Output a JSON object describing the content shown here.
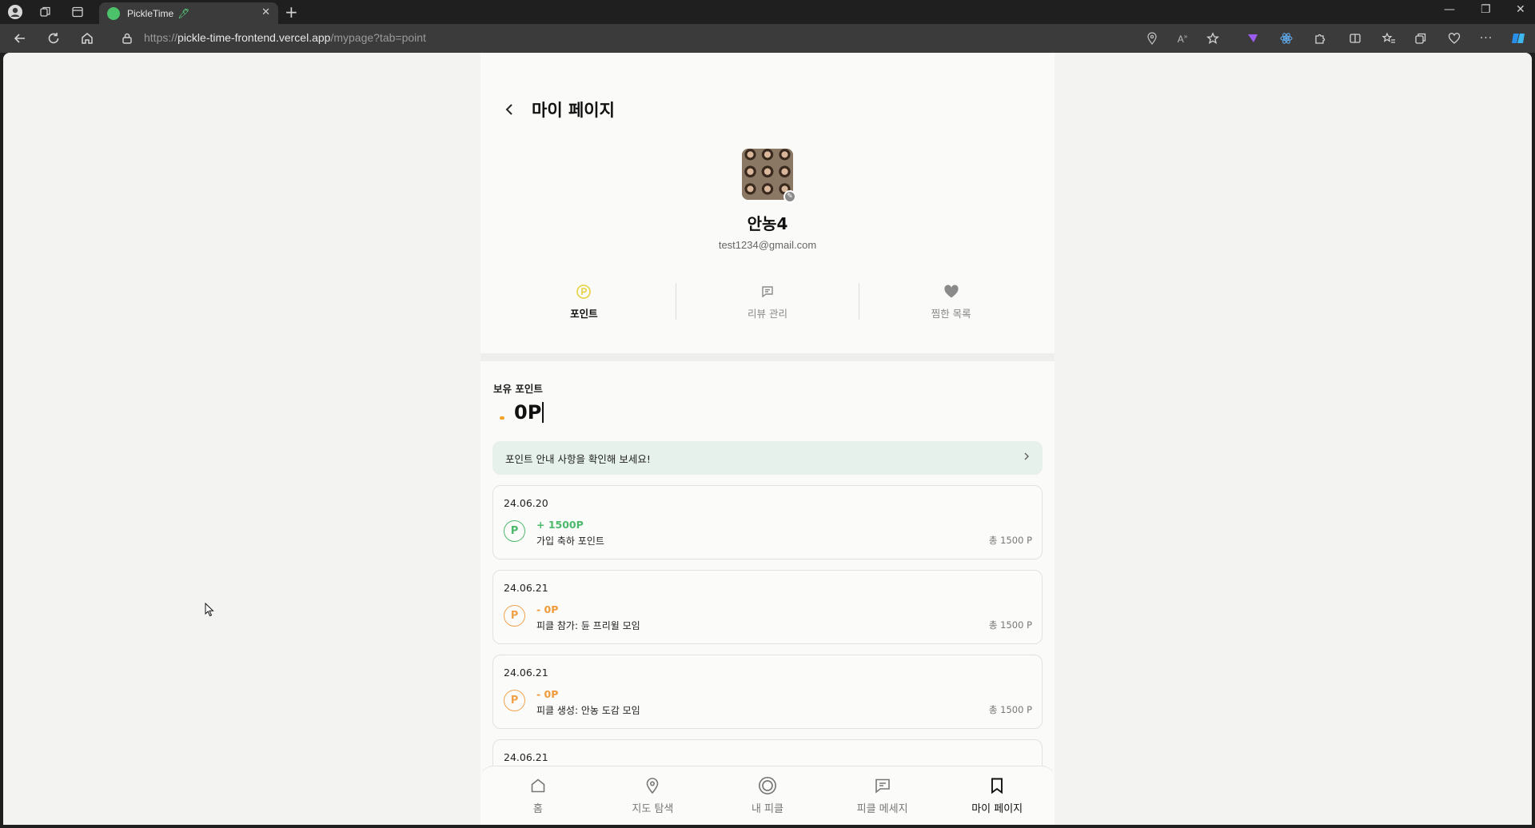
{
  "browser": {
    "tab_title": "PickleTime",
    "url_scheme": "https://",
    "url_domain": "pickle-time-frontend.vercel.app",
    "url_path": "/mypage?tab=point"
  },
  "page": {
    "title": "마이 페이지",
    "back_icon": "chevron-left-icon"
  },
  "profile": {
    "nickname": "안농4",
    "email": "test1234@gmail.com"
  },
  "tabs": [
    {
      "label": "포인트",
      "icon": "point-icon",
      "active": true
    },
    {
      "label": "리뷰 관리",
      "icon": "message-icon",
      "active": false
    },
    {
      "label": "찜한 목록",
      "icon": "heart-icon",
      "active": false
    }
  ],
  "points": {
    "label": "보유 포인트",
    "value": "0P",
    "guide_text": "포인트 안내 사항을 확인해 보세요!"
  },
  "history": [
    {
      "date": "24.06.20",
      "amount": "+ 1500P",
      "type": "plus",
      "desc": "가입 축하 포인트",
      "total": "총 1500 P",
      "icon_letter": "P"
    },
    {
      "date": "24.06.21",
      "amount": "- 0P",
      "type": "minus",
      "desc": "피클 참가: 듄 프리윌 모임",
      "total": "총 1500 P",
      "icon_letter": "P"
    },
    {
      "date": "24.06.21",
      "amount": "- 0P",
      "type": "minus",
      "desc": "피클 생성: 안농 도감 모임",
      "total": "총 1500 P",
      "icon_letter": "P"
    },
    {
      "date": "24.06.21"
    }
  ],
  "bottom_nav": [
    {
      "label": "홈",
      "icon": "home-icon"
    },
    {
      "label": "지도 탐색",
      "icon": "map-pin-icon"
    },
    {
      "label": "내 피클",
      "icon": "circle-icon"
    },
    {
      "label": "피클 메세지",
      "icon": "chat-icon"
    },
    {
      "label": "마이 페이지",
      "icon": "bookmark-icon",
      "active": true
    }
  ],
  "colors": {
    "accent_green": "#4cb86a",
    "accent_orange": "#ef9b3c",
    "guide_bg": "#e5f1ea",
    "point_icon_yellow": "#e6d13a"
  }
}
